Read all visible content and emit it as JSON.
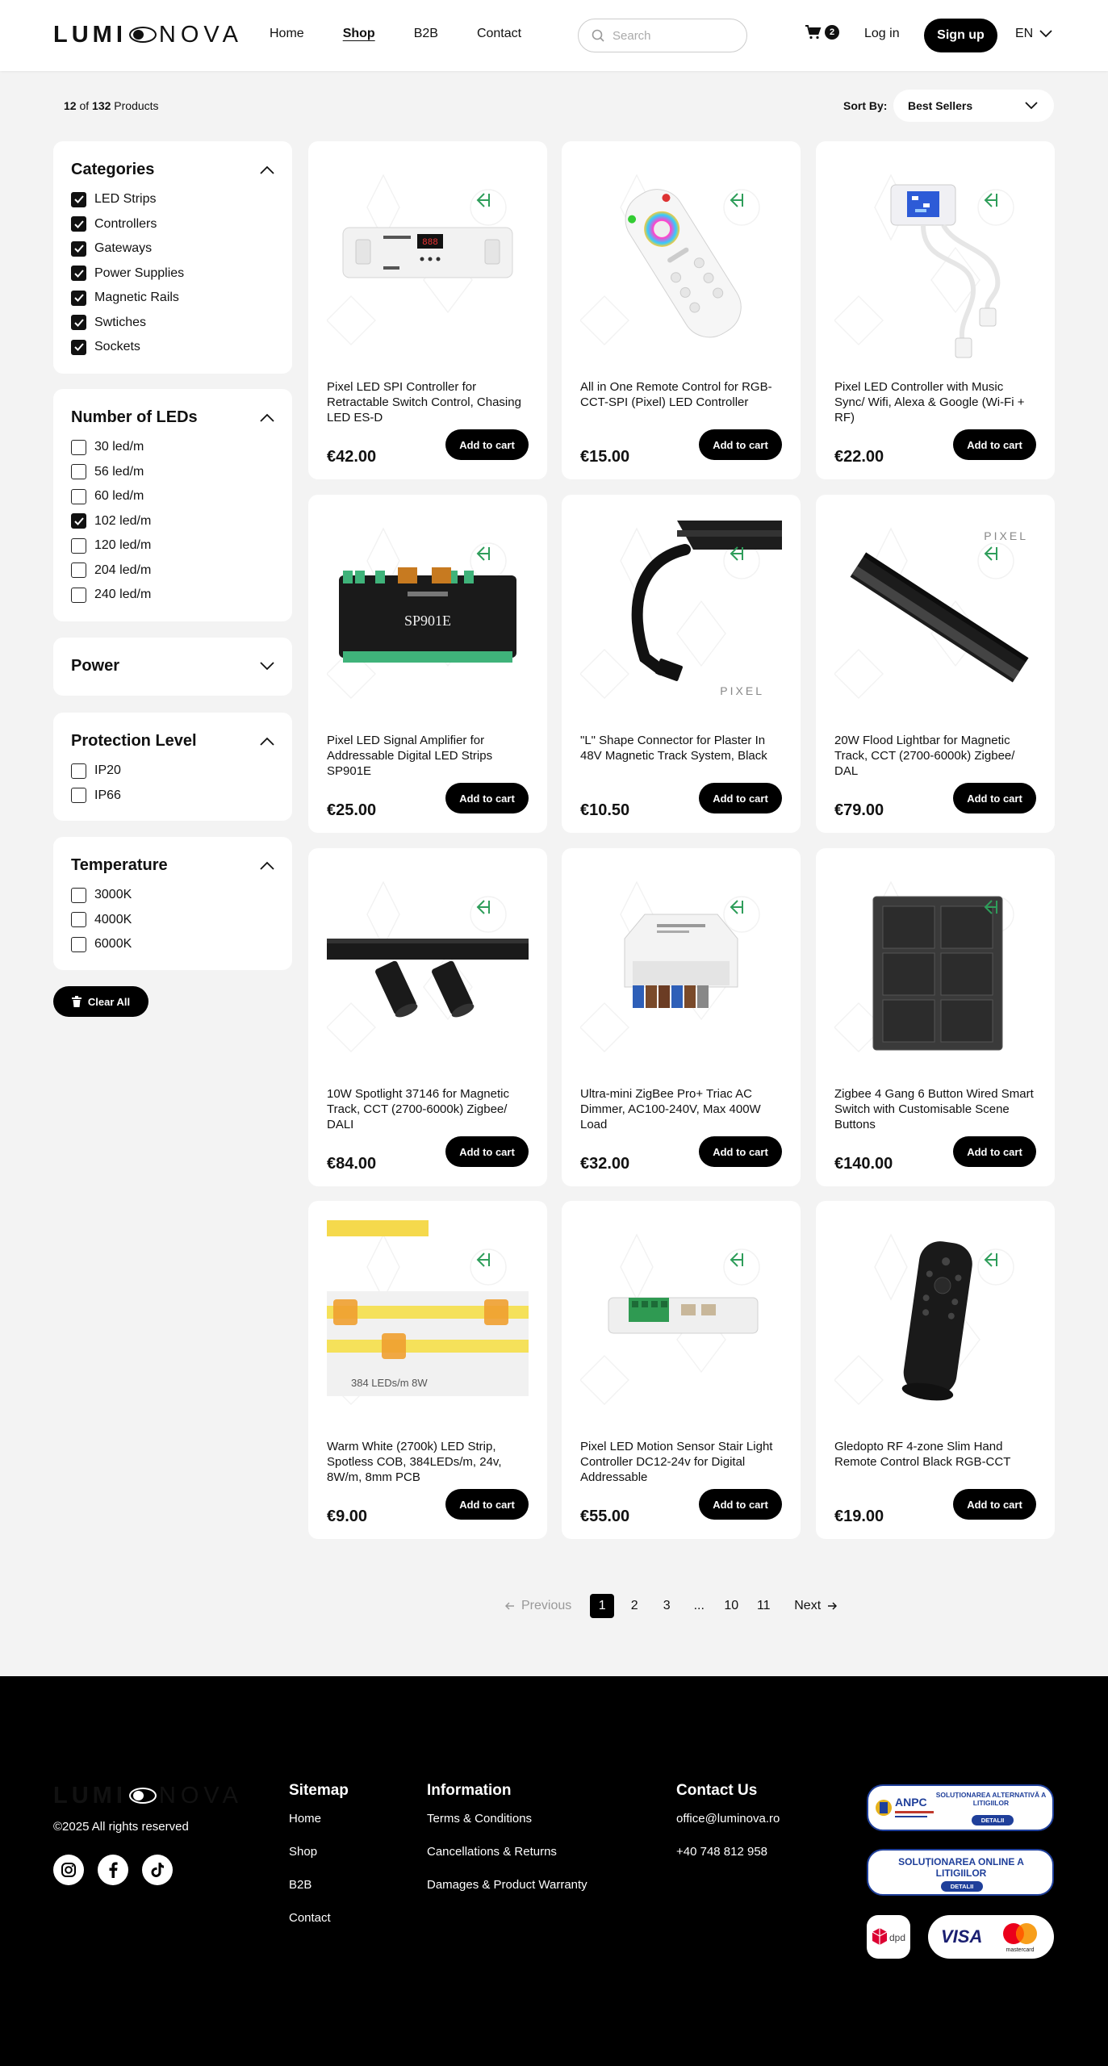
{
  "brand": {
    "part1": "LUMI",
    "part2": "NOVA"
  },
  "nav": {
    "home": "Home",
    "shop": "Shop",
    "b2b": "B2B",
    "contact": "Contact"
  },
  "search": {
    "placeholder": "Search"
  },
  "cart": {
    "count": "2"
  },
  "auth": {
    "login": "Log in",
    "signup": "Sign up"
  },
  "language": "EN",
  "results": {
    "shown": "12",
    "of": "of",
    "total": "132",
    "suffix": "Products"
  },
  "sort": {
    "label": "Sort By:",
    "value": "Best Sellers"
  },
  "filters": {
    "categories": {
      "title": "Categories",
      "options": [
        {
          "label": "LED Strips",
          "checked": true
        },
        {
          "label": "Controllers",
          "checked": true
        },
        {
          "label": "Gateways",
          "checked": true
        },
        {
          "label": "Power Supplies",
          "checked": true
        },
        {
          "label": "Magnetic Rails",
          "checked": true
        },
        {
          "label": "Swtiches",
          "checked": true
        },
        {
          "label": "Sockets",
          "checked": true
        }
      ]
    },
    "leds": {
      "title": "Number of LEDs",
      "options": [
        {
          "label": "30 led/m",
          "checked": false
        },
        {
          "label": "56 led/m",
          "checked": false
        },
        {
          "label": "60 led/m",
          "checked": false
        },
        {
          "label": "102 led/m",
          "checked": true
        },
        {
          "label": "120 led/m",
          "checked": false
        },
        {
          "label": "204 led/m",
          "checked": false
        },
        {
          "label": "240 led/m",
          "checked": false
        }
      ]
    },
    "power": {
      "title": "Power"
    },
    "protection": {
      "title": "Protection Level",
      "options": [
        {
          "label": "IP20",
          "checked": false
        },
        {
          "label": "IP66",
          "checked": false
        }
      ]
    },
    "temperature": {
      "title": "Temperature",
      "options": [
        {
          "label": "3000K",
          "checked": false
        },
        {
          "label": "4000K",
          "checked": false
        },
        {
          "label": "6000K",
          "checked": false
        }
      ]
    },
    "clear_label": "Clear All"
  },
  "add_to_cart_label": "Add to cart",
  "products": [
    {
      "name": "Pixel LED SPI Controller for Retractable Switch Control, Chasing LED ES-D",
      "price": "€42.00",
      "image": "controller-box"
    },
    {
      "name": "All in One Remote Control for RGB-CCT-SPI (Pixel) LED Controller",
      "price": "€15.00",
      "image": "remote-white"
    },
    {
      "name": "Pixel LED Controller with Music Sync/ Wifi, Alexa & Google (Wi-Fi + RF)",
      "price": "€22.00",
      "image": "wifi-controller"
    },
    {
      "name": "Pixel LED Signal Amplifier for Addressable Digital LED Strips SP901E",
      "price": "€25.00",
      "image": "signal-amplifier",
      "image_text": "SP901E"
    },
    {
      "name": "\"L\" Shape Connector for Plaster In 48V Magnetic Track System, Black",
      "price": "€10.50",
      "image": "l-connector",
      "image_text": "PIXEL"
    },
    {
      "name": "20W Flood Lightbar for Magnetic Track, CCT (2700-6000k) Zigbee/ DAL",
      "price": "€79.00",
      "image": "flood-lightbar",
      "image_text": "PIXEL"
    },
    {
      "name": "10W Spotlight 37146 for Magnetic Track, CCT (2700-6000k) Zigbee/ DALI",
      "price": "€84.00",
      "image": "spotlights"
    },
    {
      "name": "Ultra-mini ZigBee Pro+ Triac AC Dimmer, AC100-240V, Max 400W Load",
      "price": "€32.00",
      "image": "zigbee-dimmer"
    },
    {
      "name": "Zigbee 4 Gang 6 Button Wired Smart Switch with Customisable Scene Buttons",
      "price": "€140.00",
      "image": "wall-switch"
    },
    {
      "name": "Warm White (2700k) LED Strip, Spotless COB, 384LEDs/m, 24v, 8W/m, 8mm PCB",
      "price": "€9.00",
      "image": "led-strip",
      "image_text": "384 LEDs/m 8W"
    },
    {
      "name": "Pixel LED Motion Sensor Stair Light Controller DC12-24v for Digital Addressable",
      "price": "€55.00",
      "image": "stair-controller"
    },
    {
      "name": "Gledopto RF 4-zone Slim Hand Remote Control Black RGB-CCT",
      "price": "€19.00",
      "image": "remote-black"
    }
  ],
  "pagination": {
    "prev": "Previous",
    "pages": [
      "1",
      "2",
      "3",
      "...",
      "10",
      "11"
    ],
    "current": "1",
    "next": "Next"
  },
  "footer": {
    "copyright": "©2025 All rights reserved",
    "sitemap": {
      "title": "Sitemap",
      "links": [
        "Home",
        "Shop",
        "B2B",
        "Contact"
      ]
    },
    "information": {
      "title": "Information",
      "links": [
        "Terms & Conditions",
        "Cancellations & Returns",
        "Damages & Product Warranty"
      ]
    },
    "contact": {
      "title": "Contact Us",
      "email": "office@luminova.ro",
      "phone": "+40 748 812 958"
    },
    "badges": {
      "anpc_short": "ANPC",
      "sal_title": "SOLUȚIONAREA ALTERNATIVĂ A LITIGIILOR",
      "sol_title": "SOLUȚIONAREA ONLINE A LITIGIILOR",
      "details": "DETALII",
      "dpd": "dpd",
      "visa": "VISA",
      "mastercard": "mastercard"
    }
  },
  "colors": {
    "accent": "#000000",
    "background": "#f3f3f3",
    "arrow_green": "#2e9d5a",
    "badge_blue": "#1f3f9a"
  }
}
